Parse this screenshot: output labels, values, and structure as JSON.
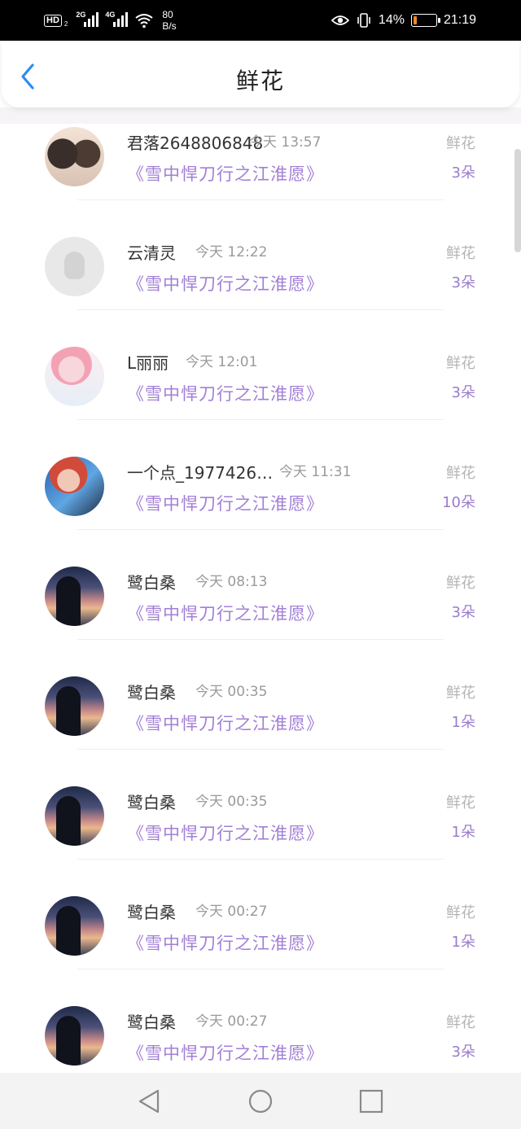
{
  "status_bar": {
    "hd_label": "HD",
    "hd_sub": "2",
    "signal1_label": "2G",
    "signal2_label": "4G",
    "speed_value": "80",
    "speed_unit": "B/s",
    "battery_percent": "14%",
    "battery_level": 0.14,
    "battery_color": "#f08a24",
    "time": "21:19"
  },
  "header": {
    "title": "鲜花",
    "back_icon": "chevron-left-icon",
    "accent_color": "#2d8cf0"
  },
  "rows": [
    {
      "name": "君落2648806848",
      "time": "今天 13:57",
      "book": "《雪中悍刀行之江淮愿》",
      "tag": "鲜花",
      "count": "3朵",
      "avatar": "couple-photo-avatar"
    },
    {
      "name": "云清灵",
      "time": "今天 12:22",
      "book": "《雪中悍刀行之江淮愿》",
      "tag": "鲜花",
      "count": "3朵",
      "avatar": "default-avatar"
    },
    {
      "name": "L丽丽",
      "time": "今天 12:01",
      "book": "《雪中悍刀行之江淮愿》",
      "tag": "鲜花",
      "count": "3朵",
      "avatar": "anime-girl-avatar"
    },
    {
      "name": "一个点_1977426…",
      "time": "今天 11:31",
      "book": "《雪中悍刀行之江淮愿》",
      "tag": "鲜花",
      "count": "10朵",
      "avatar": "red-hair-girl-avatar"
    },
    {
      "name": "鹭白桑",
      "time": "今天 08:13",
      "book": "《雪中悍刀行之江淮愿》",
      "tag": "鲜花",
      "count": "3朵",
      "avatar": "sunset-silhouette-avatar"
    },
    {
      "name": "鹭白桑",
      "time": "今天 00:35",
      "book": "《雪中悍刀行之江淮愿》",
      "tag": "鲜花",
      "count": "1朵",
      "avatar": "sunset-silhouette-avatar"
    },
    {
      "name": "鹭白桑",
      "time": "今天 00:35",
      "book": "《雪中悍刀行之江淮愿》",
      "tag": "鲜花",
      "count": "1朵",
      "avatar": "sunset-silhouette-avatar"
    },
    {
      "name": "鹭白桑",
      "time": "今天 00:27",
      "book": "《雪中悍刀行之江淮愿》",
      "tag": "鲜花",
      "count": "1朵",
      "avatar": "sunset-silhouette-avatar"
    },
    {
      "name": "鹭白桑",
      "time": "今天 00:27",
      "book": "《雪中悍刀行之江淮愿》",
      "tag": "鲜花",
      "count": "3朵",
      "avatar": "sunset-silhouette-avatar"
    }
  ],
  "colors": {
    "book_title": "#a27fd6",
    "count": "#9a7ccc",
    "meta": "#9a9a9a"
  },
  "nav_bar": {
    "back": "triangle-back-icon",
    "home": "circle-home-icon",
    "recents": "square-recents-icon"
  }
}
